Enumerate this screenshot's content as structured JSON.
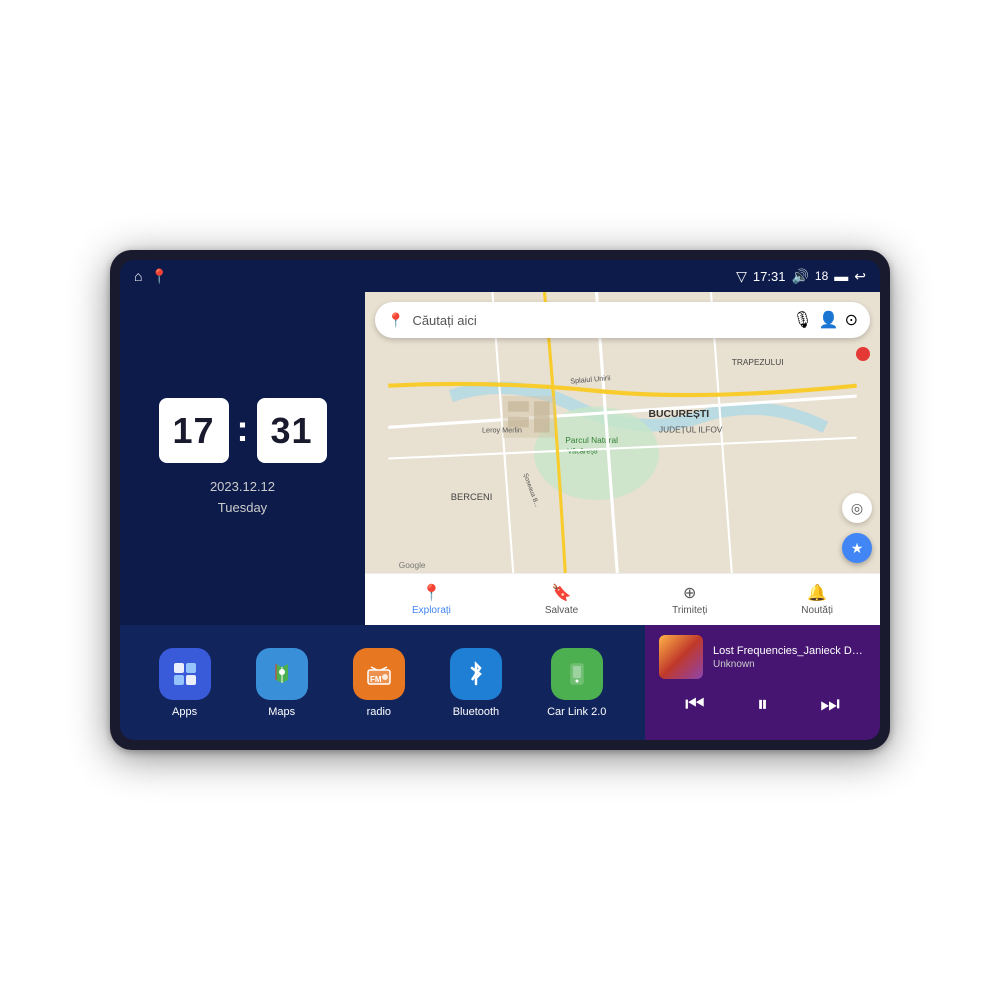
{
  "device": {
    "statusBar": {
      "leftIcons": [
        "⌂",
        "📍"
      ],
      "time": "17:31",
      "volume_icon": "🔊",
      "battery_level": "18",
      "battery_icon": "🔋",
      "back_icon": "↩"
    },
    "clock": {
      "hour": "17",
      "minute": "31",
      "date": "2023.12.12",
      "day": "Tuesday"
    },
    "map": {
      "search_placeholder": "Căutați aici",
      "labels": {
        "parcul": "Parcul Natural Văcărești",
        "leroy": "Leroy Merlin",
        "bucuresti": "BUCUREȘTI",
        "ilfov": "JUDEȚUL ILFOV",
        "berceni": "BERCENI",
        "trapezului": "TRAPEZULUI",
        "google": "Google"
      },
      "tabs": [
        {
          "id": "explorare",
          "label": "Explorați",
          "active": true
        },
        {
          "id": "salvate",
          "label": "Salvate",
          "active": false
        },
        {
          "id": "trimiteti",
          "label": "Trimiteți",
          "active": false
        },
        {
          "id": "noutati",
          "label": "Noutăți",
          "active": false
        }
      ]
    },
    "apps": [
      {
        "id": "apps",
        "label": "Apps",
        "icon": "⊞",
        "bg": "#3a5bd9"
      },
      {
        "id": "maps",
        "label": "Maps",
        "icon": "📍",
        "bg": "#3a8fd9"
      },
      {
        "id": "radio",
        "label": "radio",
        "icon": "📻",
        "bg": "#e87722"
      },
      {
        "id": "bluetooth",
        "label": "Bluetooth",
        "icon": "⟁",
        "bg": "#1e7fd4"
      },
      {
        "id": "carlink",
        "label": "Car Link 2.0",
        "icon": "📱",
        "bg": "#4caf50"
      }
    ],
    "music": {
      "title": "Lost Frequencies_Janieck Devy-...",
      "artist": "Unknown",
      "controls": {
        "prev": "⏮",
        "play": "⏸",
        "next": "⏭"
      }
    }
  }
}
